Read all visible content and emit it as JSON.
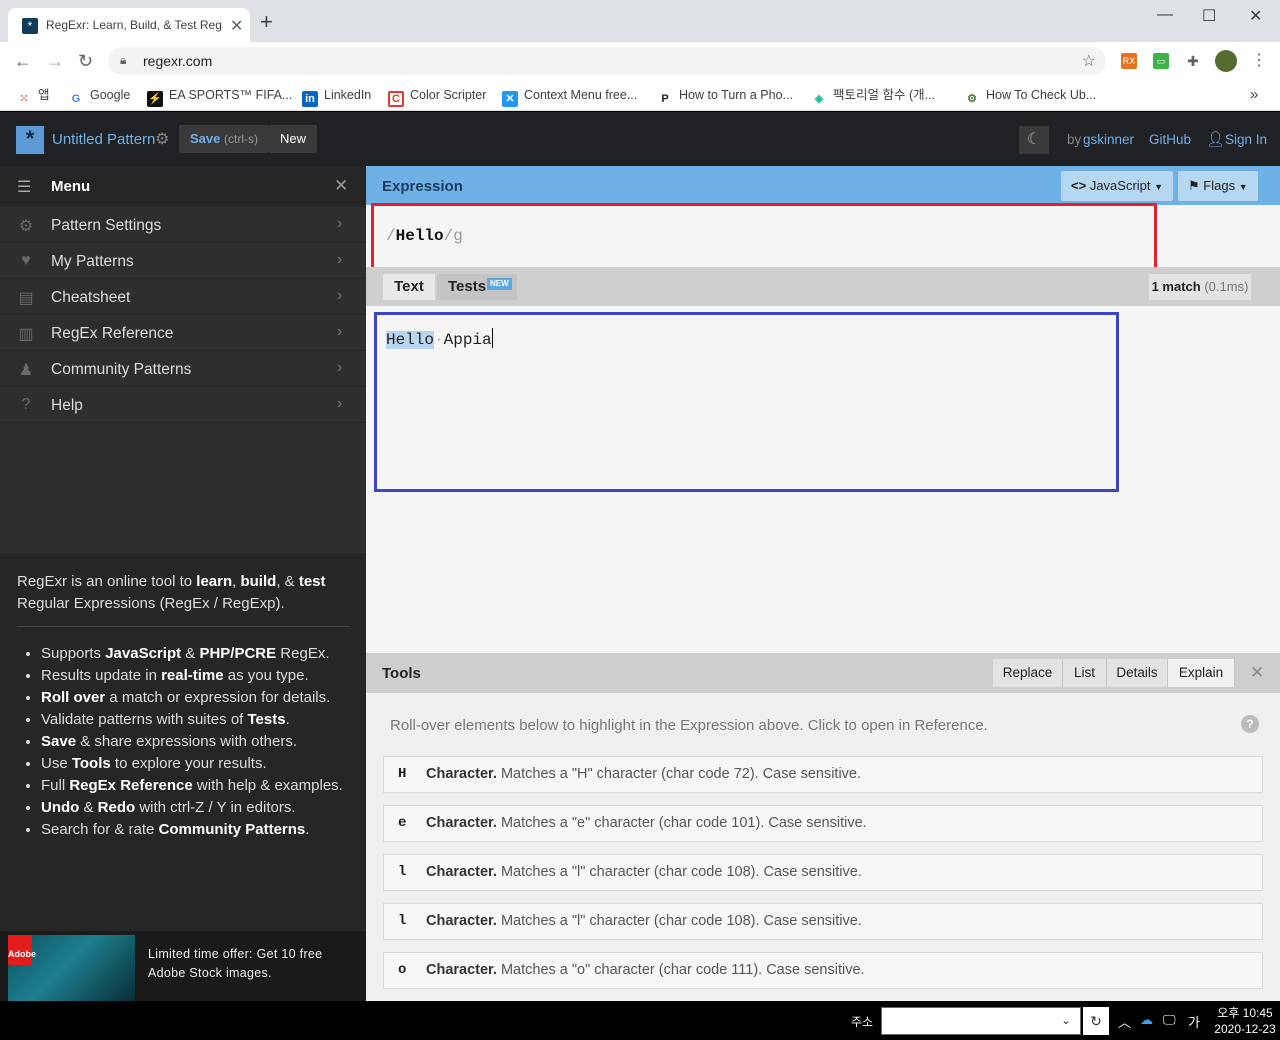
{
  "browser": {
    "tab_title": "RegExr: Learn, Build, & Test RegEx",
    "url": "regexr.com",
    "bookmarks": [
      {
        "label": "앱",
        "icon": "apps-grid-icon"
      },
      {
        "label": "Google",
        "icon": "google-icon"
      },
      {
        "label": "EA SPORTS™ FIFA...",
        "icon": "ea-sports-icon"
      },
      {
        "label": "LinkedIn",
        "icon": "linkedin-icon"
      },
      {
        "label": "Color Scripter",
        "icon": "color-scripter-icon"
      },
      {
        "label": "Context Menu free...",
        "icon": "context-menu-icon"
      },
      {
        "label": "How to Turn a Pho...",
        "icon": "p-icon"
      },
      {
        "label": "팩토리얼 함수 (개...",
        "icon": "factorial-icon"
      },
      {
        "label": "How To Check Ub...",
        "icon": "gear-icon"
      }
    ]
  },
  "header": {
    "pattern_name": "Untitled Pattern",
    "save_label": "Save",
    "save_hint": "(ctrl-s)",
    "new_label": "New",
    "by_prefix": "by",
    "author": "gskinner",
    "github": "GitHub",
    "sign_in": "Sign In"
  },
  "menu": {
    "title": "Menu",
    "items": [
      {
        "label": "Pattern Settings",
        "icon": "gear-icon"
      },
      {
        "label": "My Patterns",
        "icon": "heart-icon"
      },
      {
        "label": "Cheatsheet",
        "icon": "cheatsheet-icon"
      },
      {
        "label": "RegEx Reference",
        "icon": "book-icon"
      },
      {
        "label": "Community Patterns",
        "icon": "community-icon"
      },
      {
        "label": "Help",
        "icon": "help-icon"
      }
    ]
  },
  "about": {
    "intro_parts": [
      "RegExr is an online tool to ",
      "learn",
      ", ",
      "build",
      ", & ",
      "test",
      " Regular Expressions (RegEx / RegExp)."
    ],
    "bullets": [
      [
        "Supports ",
        "JavaScript",
        " & ",
        "PHP/PCRE",
        " RegEx."
      ],
      [
        "Results update in ",
        "real-time",
        " as you type."
      ],
      [
        "",
        "Roll over",
        " a match or expression for details."
      ],
      [
        "Validate patterns with suites of ",
        "Tests",
        "."
      ],
      [
        "",
        "Save",
        " & share expressions with others."
      ],
      [
        "Use ",
        "Tools",
        " to explore your results."
      ],
      [
        "Full ",
        "RegEx Reference",
        " with help & examples."
      ],
      [
        "",
        "Undo",
        " & ",
        "Redo",
        " with ctrl-Z / Y in editors."
      ],
      [
        "Search for & rate ",
        "Community Patterns",
        "."
      ]
    ]
  },
  "ad": {
    "text": "Limited time offer: Get 10 free Adobe Stock images.",
    "logo_text": "Adobe"
  },
  "expression": {
    "title": "Expression",
    "flavor": "JavaScript",
    "flags_label": "Flags",
    "open_slash": "/",
    "pattern": "Hello",
    "close_slash": "/",
    "flags": "g"
  },
  "text_panel": {
    "tab_text": "Text",
    "tab_tests": "Tests",
    "new_badge": "NEW",
    "match_count": "1 match",
    "match_time": "(0.1ms)",
    "content_match": "Hello",
    "space_marker": "·",
    "content_rest": "Appia"
  },
  "tools": {
    "title": "Tools",
    "buttons": [
      "Replace",
      "List",
      "Details",
      "Explain"
    ],
    "note": "Roll-over elements below to highlight in the Expression above. Click to open in Reference.",
    "explain": [
      {
        "char": "H",
        "kind": "Character.",
        "desc": "Matches a \"H\" character (char code 72). Case sensitive."
      },
      {
        "char": "e",
        "kind": "Character.",
        "desc": "Matches a \"e\" character (char code 101). Case sensitive."
      },
      {
        "char": "l",
        "kind": "Character.",
        "desc": "Matches a \"l\" character (char code 108). Case sensitive."
      },
      {
        "char": "l",
        "kind": "Character.",
        "desc": "Matches a \"l\" character (char code 108). Case sensitive."
      },
      {
        "char": "o",
        "kind": "Character.",
        "desc": "Matches a \"o\" character (char code 111). Case sensitive."
      }
    ]
  },
  "taskbar": {
    "address_label": "주소",
    "ime": "가",
    "time": "오후 10:45",
    "date": "2020-12-23"
  },
  "colors": {
    "accent": "#6fb1e4",
    "highlight_red": "#e4202c",
    "highlight_blue": "#3d45c2",
    "match_bg": "#b9d6f1"
  }
}
